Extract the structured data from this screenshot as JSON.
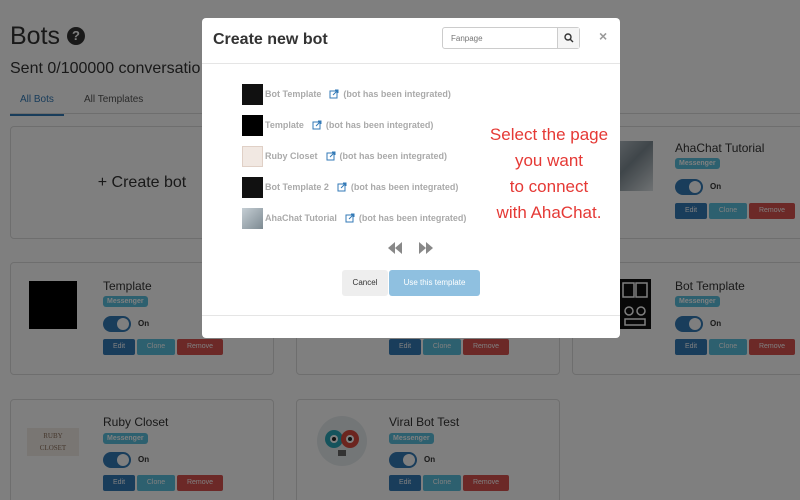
{
  "page": {
    "title": "Bots",
    "help_icon": "question-circle-icon",
    "sent": "Sent 0/100000 conversatio",
    "tabs": [
      {
        "label": "All Bots",
        "active": true
      },
      {
        "label": "All Templates",
        "active": false
      }
    ]
  },
  "create_bot": {
    "label": "+ Create bot"
  },
  "bots": [
    {
      "name": "AhaChat Tutorial",
      "badge": "Messenger",
      "status": "On",
      "edit": "Edit",
      "clone": "Clone",
      "remove": "Remove"
    },
    {
      "name": "Template",
      "badge": "Messenger",
      "status": "On",
      "edit": "Edit",
      "clone": "Clone",
      "remove": "Remove"
    },
    {
      "name": "",
      "badge": "",
      "status": "",
      "edit": "Edit",
      "clone": "Clone",
      "remove": "Remove"
    },
    {
      "name": "Bot Template",
      "badge": "Messenger",
      "status": "On",
      "edit": "Edit",
      "clone": "Clone",
      "remove": "Remove"
    },
    {
      "name": "Ruby Closet",
      "badge": "Messenger",
      "status": "On",
      "edit": "Edit",
      "clone": "Clone",
      "remove": "Remove"
    },
    {
      "name": "Viral Bot Test",
      "badge": "Messenger",
      "status": "On",
      "edit": "Edit",
      "clone": "Clone",
      "remove": "Remove"
    }
  ],
  "modal": {
    "title": "Create new bot",
    "search_placeholder": "Fanpage",
    "close": "×",
    "pages": [
      {
        "name": "Bot Template",
        "status": "(bot has been integrated)"
      },
      {
        "name": "Template",
        "status": "(bot has been integrated)"
      },
      {
        "name": "Ruby Closet",
        "status": "(bot has been integrated)"
      },
      {
        "name": "Bot Template 2",
        "status": "(bot has been integrated)"
      },
      {
        "name": "AhaChat Tutorial",
        "status": "(bot has been integrated)"
      }
    ],
    "cancel": "Cancel",
    "use_template": "Use this template"
  },
  "annotation": [
    "Select the page",
    "you want",
    "to connect",
    "with AhaChat."
  ],
  "colors": {
    "primary": "#337ab7",
    "info": "#5bc0de",
    "danger": "#d9534f",
    "annotation": "#e53935"
  }
}
